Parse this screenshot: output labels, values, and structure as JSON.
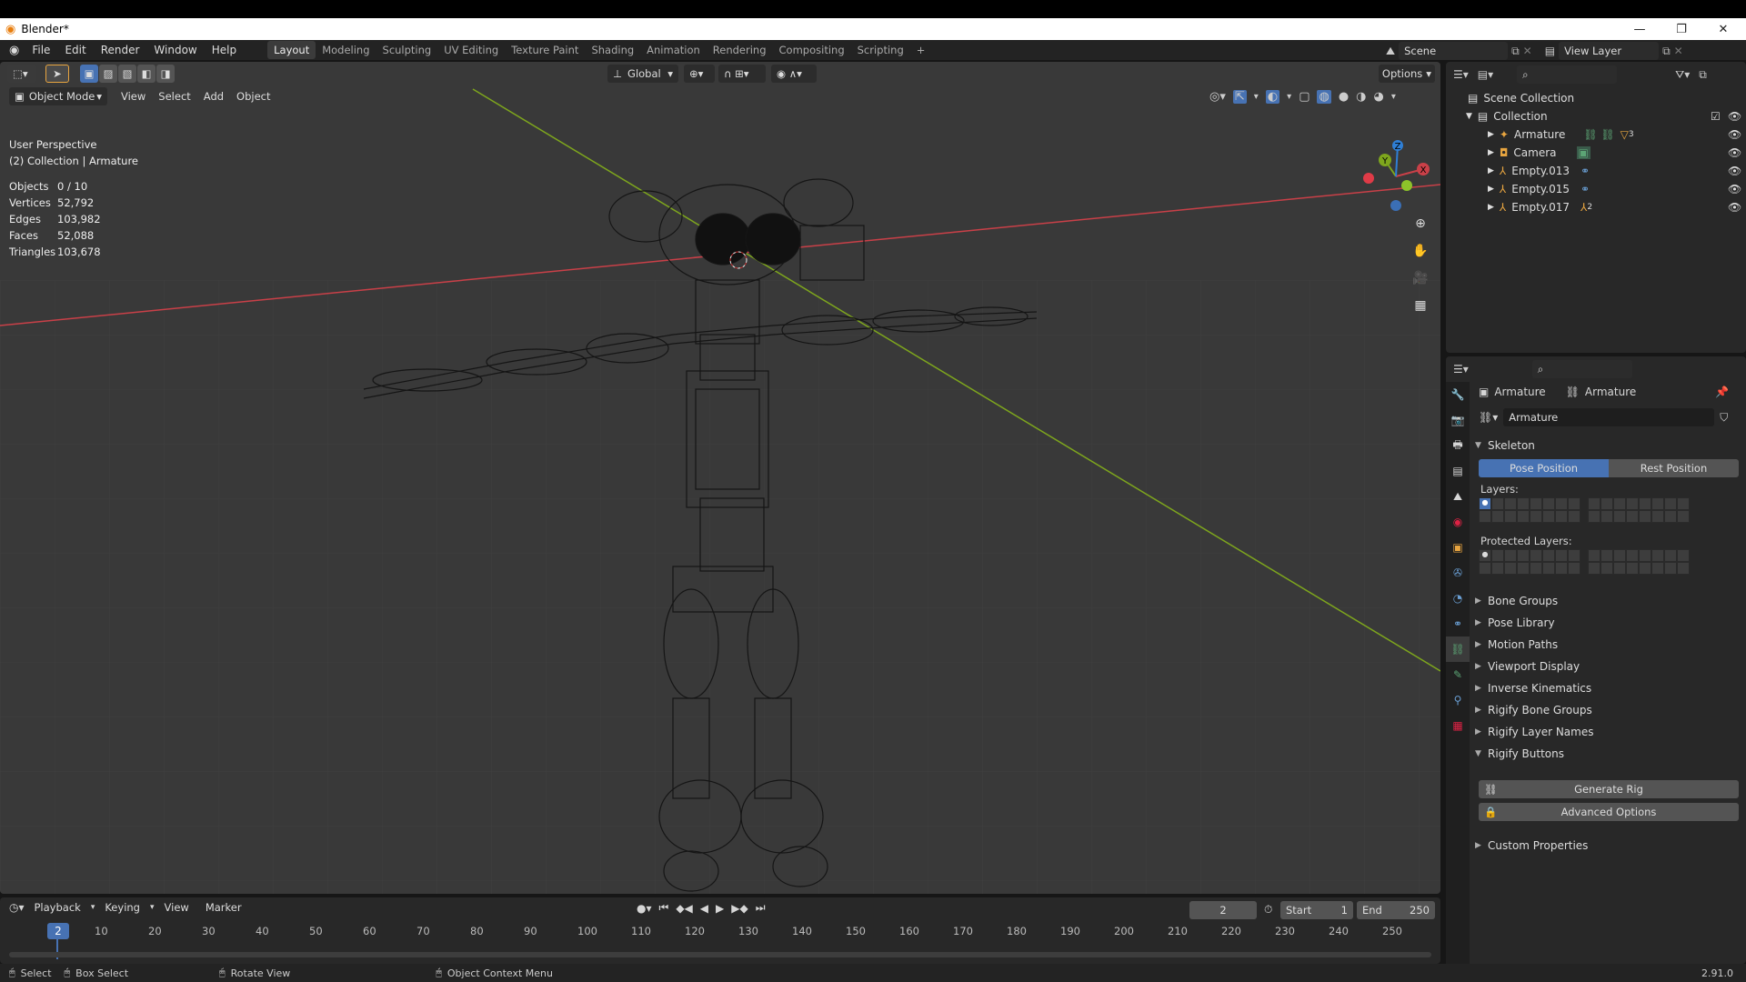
{
  "window": {
    "title": "Blender*",
    "minimize": "—",
    "restore": "❐",
    "close": "✕"
  },
  "menu": [
    "File",
    "Edit",
    "Render",
    "Window",
    "Help"
  ],
  "workspaces": [
    "Layout",
    "Modeling",
    "Sculpting",
    "UV Editing",
    "Texture Paint",
    "Shading",
    "Animation",
    "Rendering",
    "Compositing",
    "Scripting"
  ],
  "active_workspace": "Layout",
  "add_workspace": "+",
  "scene": {
    "label": "Scene",
    "view_layer": "View Layer"
  },
  "viewport": {
    "orientation": "Global",
    "options": "Options",
    "mode": "Object Mode",
    "menus": [
      "View",
      "Select",
      "Add",
      "Object"
    ],
    "perspective": "User Perspective",
    "collection_info": "(2) Collection | Armature",
    "stats": [
      {
        "k": "Objects",
        "v": "0 / 10"
      },
      {
        "k": "Vertices",
        "v": "52,792"
      },
      {
        "k": "Edges",
        "v": "103,982"
      },
      {
        "k": "Faces",
        "v": "52,088"
      },
      {
        "k": "Triangles",
        "v": "103,678"
      }
    ],
    "gizmo": {
      "x": "X",
      "y": "Y",
      "z": "Z"
    }
  },
  "outliner": {
    "root": "Scene Collection",
    "collection": "Collection",
    "items": [
      {
        "name": "Armature"
      },
      {
        "name": "Camera"
      },
      {
        "name": "Empty.013"
      },
      {
        "name": "Empty.015"
      },
      {
        "name": "Empty.017"
      }
    ],
    "armature_badge": "3",
    "empty017_badge": "2"
  },
  "properties": {
    "breadcrumb1": "Armature",
    "breadcrumb2": "Armature",
    "data_name": "Armature",
    "skeleton": "Skeleton",
    "pose_position": "Pose Position",
    "rest_position": "Rest Position",
    "layers": "Layers:",
    "protected_layers": "Protected Layers:",
    "panels": [
      "Bone Groups",
      "Pose Library",
      "Motion Paths",
      "Viewport Display",
      "Inverse Kinematics",
      "Rigify Bone Groups",
      "Rigify Layer Names"
    ],
    "rigify_buttons": "Rigify Buttons",
    "generate_rig": "Generate Rig",
    "advanced_options": "Advanced Options",
    "custom_properties": "Custom Properties"
  },
  "timeline": {
    "menus": [
      "Playback",
      "Keying",
      "View",
      "Marker"
    ],
    "current_frame": "2",
    "start_label": "Start",
    "start": "1",
    "end_label": "End",
    "end": "250",
    "ticks": [
      "10",
      "20",
      "30",
      "40",
      "50",
      "60",
      "70",
      "80",
      "90",
      "100",
      "110",
      "120",
      "130",
      "140",
      "150",
      "160",
      "170",
      "180",
      "190",
      "200",
      "210",
      "220",
      "230",
      "240",
      "250"
    ],
    "playhead": "2"
  },
  "status": {
    "select": "Select",
    "box_select": "Box Select",
    "rotate_view": "Rotate View",
    "context_menu": "Object Context Menu",
    "version": "2.91.0"
  },
  "colors": {
    "accent": "#4772b3",
    "x_axis": "#c94048",
    "y_axis": "#7ea61d",
    "z_axis": "#2f7fd6"
  }
}
